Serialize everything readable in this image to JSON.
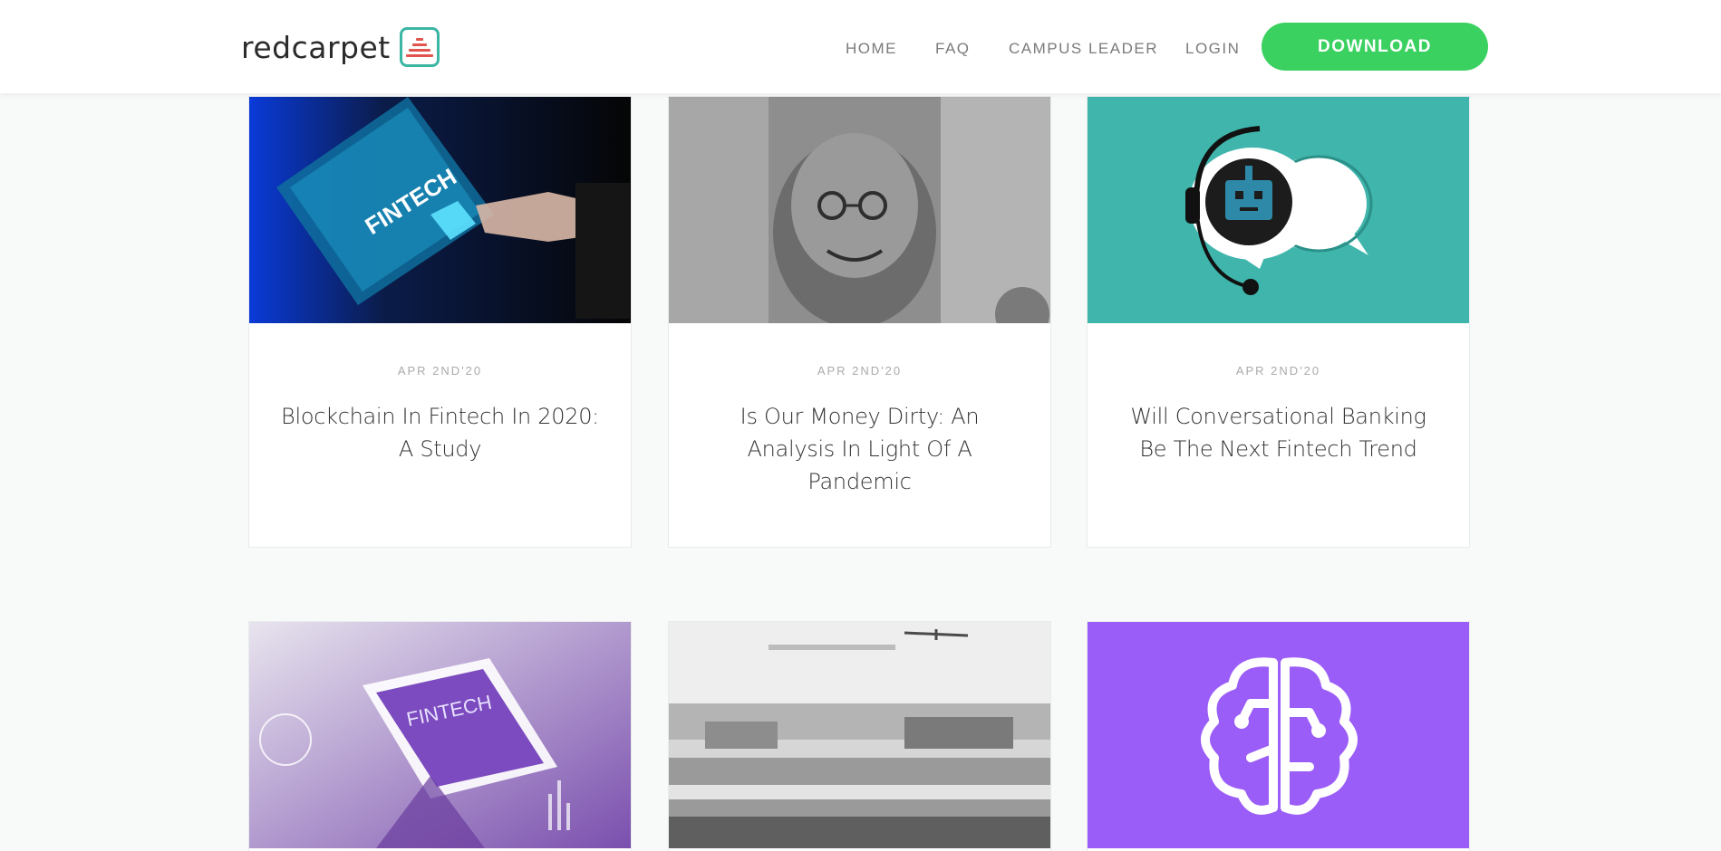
{
  "header": {
    "logo_text": "redcarpet",
    "nav": [
      "HOME",
      "FAQ",
      "CAMPUS LEADER",
      "LOGIN"
    ],
    "download_label": "DOWNLOAD"
  },
  "posts": [
    {
      "date": "APR 2ND'20",
      "title": "Blockchain In Fintech In 2020: A Study",
      "image": "fintech-tablet-image"
    },
    {
      "date": "APR 2ND'20",
      "title": "Is Our Money Dirty: An Analysis In Light Of A Pandemic",
      "image": "rupee-note-image"
    },
    {
      "date": "APR 2ND'20",
      "title": "Will Conversational Banking Be The Next Fintech Trend",
      "image": "chatbot-image"
    },
    {
      "image": "fintech-financial-technology-image"
    },
    {
      "image": "office-room-image"
    },
    {
      "image": "brain-icon-image"
    }
  ],
  "colors": {
    "accent_green": "#3bd160",
    "teal": "#3fb5ac",
    "purple": "#9b5df7",
    "logo_red": "#e2554f"
  }
}
